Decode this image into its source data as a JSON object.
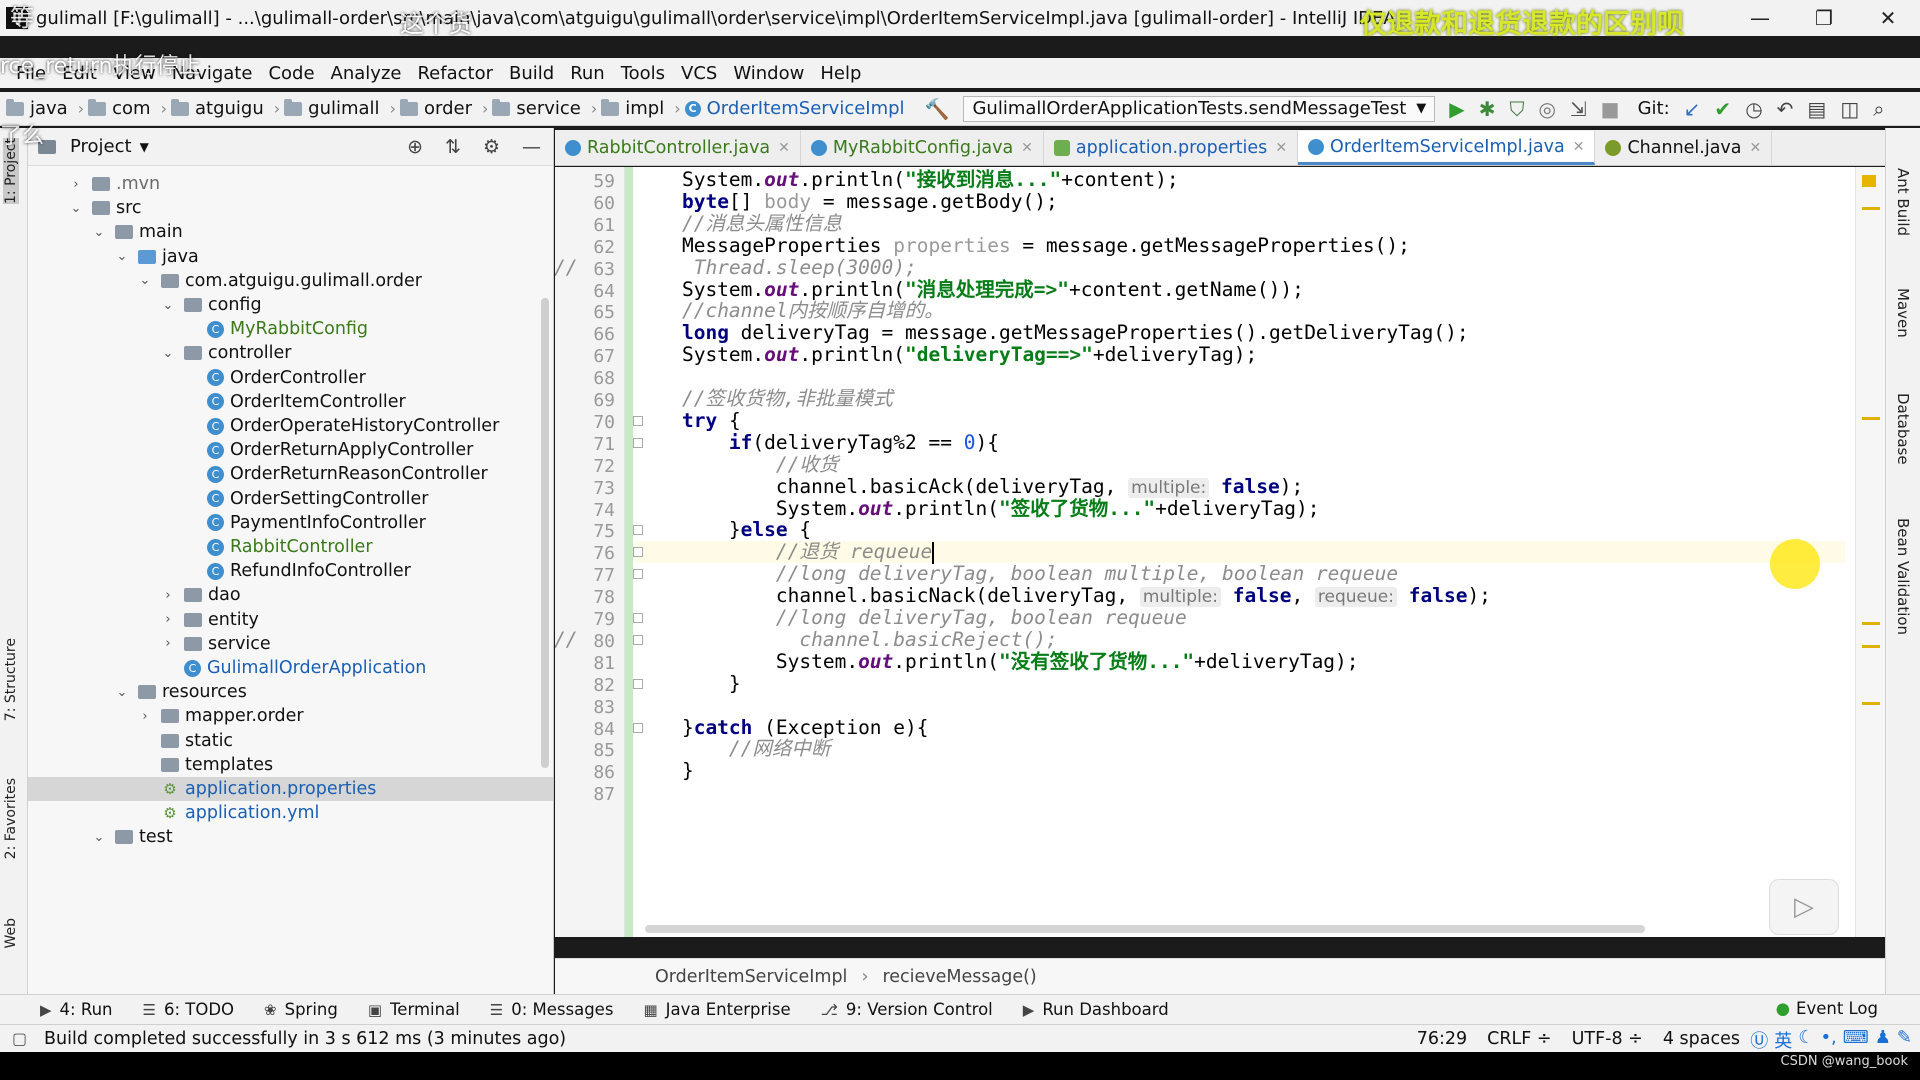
{
  "window": {
    "title": "gulimall [F:\\gulimall] - ...\\gulimall-order\\src\\main\\java\\com\\atguigu\\gulimall\\order\\service\\impl\\OrderItemServiceImpl.java [gulimall-order] - IntelliJ IDEA",
    "overlay_caption": "仅退款和退货退款的区别呗",
    "minimize": "—",
    "restore": "❐",
    "close": "✕"
  },
  "video_overlay": {
    "top_left_text_1": "等",
    "top_left_text_2": "这个货",
    "subtitle_1": "rce_return执行停止",
    "subtitle_2": "了么"
  },
  "menu": [
    "File",
    "Edit",
    "View",
    "Navigate",
    "Code",
    "Analyze",
    "Refactor",
    "Build",
    "Run",
    "Tools",
    "VCS",
    "Window",
    "Help"
  ],
  "breadcrumb": [
    "java",
    "com",
    "atguigu",
    "gulimall",
    "order",
    "service",
    "impl"
  ],
  "breadcrumb_active": "OrderItemServiceImpl",
  "run_config": "GulimallOrderApplicationTests.sendMessageTest",
  "git_label": "Git:",
  "project_panel": {
    "title": "Project",
    "rows": [
      {
        "label": ".mvn",
        "depth": 2,
        "kind": "folder",
        "arrow": "›",
        "muted": true
      },
      {
        "label": "src",
        "depth": 2,
        "kind": "folder",
        "arrow": "⌄"
      },
      {
        "label": "main",
        "depth": 3,
        "kind": "folder",
        "arrow": "⌄"
      },
      {
        "label": "java",
        "depth": 4,
        "kind": "folder-blue",
        "arrow": "⌄"
      },
      {
        "label": "com.atguigu.gulimall.order",
        "depth": 5,
        "kind": "folder",
        "arrow": "⌄"
      },
      {
        "label": "config",
        "depth": 6,
        "kind": "folder",
        "arrow": "⌄"
      },
      {
        "label": "MyRabbitConfig",
        "depth": 7,
        "kind": "class",
        "color": "green"
      },
      {
        "label": "controller",
        "depth": 6,
        "kind": "folder",
        "arrow": "⌄"
      },
      {
        "label": "OrderController",
        "depth": 7,
        "kind": "class"
      },
      {
        "label": "OrderItemController",
        "depth": 7,
        "kind": "class"
      },
      {
        "label": "OrderOperateHistoryController",
        "depth": 7,
        "kind": "class"
      },
      {
        "label": "OrderReturnApplyController",
        "depth": 7,
        "kind": "class"
      },
      {
        "label": "OrderReturnReasonController",
        "depth": 7,
        "kind": "class"
      },
      {
        "label": "OrderSettingController",
        "depth": 7,
        "kind": "class"
      },
      {
        "label": "PaymentInfoController",
        "depth": 7,
        "kind": "class"
      },
      {
        "label": "RabbitController",
        "depth": 7,
        "kind": "class",
        "color": "green"
      },
      {
        "label": "RefundInfoController",
        "depth": 7,
        "kind": "class"
      },
      {
        "label": "dao",
        "depth": 6,
        "kind": "folder",
        "arrow": "›"
      },
      {
        "label": "entity",
        "depth": 6,
        "kind": "folder",
        "arrow": "›"
      },
      {
        "label": "service",
        "depth": 6,
        "kind": "folder",
        "arrow": "›"
      },
      {
        "label": "GulimallOrderApplication",
        "depth": 6,
        "kind": "class",
        "color": "blue"
      },
      {
        "label": "resources",
        "depth": 4,
        "kind": "folder",
        "arrow": "⌄"
      },
      {
        "label": "mapper.order",
        "depth": 5,
        "kind": "folder",
        "arrow": "›"
      },
      {
        "label": "static",
        "depth": 5,
        "kind": "folder"
      },
      {
        "label": "templates",
        "depth": 5,
        "kind": "folder"
      },
      {
        "label": "application.properties",
        "depth": 5,
        "kind": "prop",
        "color": "blue",
        "selected": true
      },
      {
        "label": "application.yml",
        "depth": 5,
        "kind": "prop",
        "color": "blue"
      },
      {
        "label": "test",
        "depth": 3,
        "kind": "folder",
        "arrow": "⌄"
      }
    ]
  },
  "editor_tabs": [
    {
      "label": "RabbitController.java",
      "icon": "class",
      "color": "green"
    },
    {
      "label": "MyRabbitConfig.java",
      "icon": "class",
      "color": "green"
    },
    {
      "label": "application.properties",
      "icon": "prop",
      "color": "blue"
    },
    {
      "label": "OrderItemServiceImpl.java",
      "icon": "class",
      "color": "blue",
      "active": true
    },
    {
      "label": "Channel.java",
      "icon": "iface",
      "color": "black"
    }
  ],
  "code": {
    "first_line": 59,
    "current_line": 76,
    "lines": [
      [
        {
          "t": "    System."
        },
        {
          "t": "out",
          "c": "fld"
        },
        {
          "t": ".println("
        },
        {
          "t": "\"接收到消息...\"",
          "c": "str"
        },
        {
          "t": "+content);"
        }
      ],
      [
        {
          "t": "    "
        },
        {
          "t": "byte",
          "c": "kw"
        },
        {
          "t": "[] "
        },
        {
          "t": "body",
          "c": "unused"
        },
        {
          "t": " = message.getBody();"
        }
      ],
      [
        {
          "t": "    "
        },
        {
          "t": "//消息头属性信息",
          "c": "cm"
        }
      ],
      [
        {
          "t": "    MessageProperties "
        },
        {
          "t": "properties",
          "c": "unused"
        },
        {
          "t": " = message.getMessageProperties();"
        }
      ],
      [
        {
          "t": "     "
        },
        {
          "t": "Thread.sleep(3000);",
          "c": "cm"
        }
      ],
      [
        {
          "t": "    System."
        },
        {
          "t": "out",
          "c": "fld"
        },
        {
          "t": ".println("
        },
        {
          "t": "\"消息处理完成=>\"",
          "c": "str"
        },
        {
          "t": "+content.getName());"
        }
      ],
      [
        {
          "t": "    "
        },
        {
          "t": "//channel内按顺序自增的。",
          "c": "cm"
        }
      ],
      [
        {
          "t": "    "
        },
        {
          "t": "long",
          "c": "kw"
        },
        {
          "t": " deliveryTag = message.getMessageProperties().getDeliveryTag();"
        }
      ],
      [
        {
          "t": "    System."
        },
        {
          "t": "out",
          "c": "fld"
        },
        {
          "t": ".println("
        },
        {
          "t": "\"deliveryTag==>\"",
          "c": "str"
        },
        {
          "t": "+deliveryTag);"
        }
      ],
      [
        {
          "t": ""
        }
      ],
      [
        {
          "t": "    "
        },
        {
          "t": "//签收货物,非批量模式",
          "c": "cm"
        }
      ],
      [
        {
          "t": "    "
        },
        {
          "t": "try",
          "c": "kw"
        },
        {
          "t": " {"
        }
      ],
      [
        {
          "t": "        "
        },
        {
          "t": "if",
          "c": "kw"
        },
        {
          "t": "(deliveryTag%2 == "
        },
        {
          "t": "0",
          "c": "num"
        },
        {
          "t": "){"
        }
      ],
      [
        {
          "t": "            "
        },
        {
          "t": "//收货",
          "c": "cm"
        }
      ],
      [
        {
          "t": "            channel.basicAck(deliveryTag, "
        },
        {
          "t": "multiple:",
          "c": "hint"
        },
        {
          "t": " "
        },
        {
          "t": "false",
          "c": "kw"
        },
        {
          "t": ");"
        }
      ],
      [
        {
          "t": "            System."
        },
        {
          "t": "out",
          "c": "fld"
        },
        {
          "t": ".println("
        },
        {
          "t": "\"签收了货物...\"",
          "c": "str"
        },
        {
          "t": "+deliveryTag);"
        }
      ],
      [
        {
          "t": "        }"
        },
        {
          "t": "else",
          "c": "kw"
        },
        {
          "t": " {"
        }
      ],
      [
        {
          "t": "            "
        },
        {
          "t": "//退货 requeue",
          "c": "cm"
        },
        {
          "t": "",
          "c": "caret"
        }
      ],
      [
        {
          "t": "            "
        },
        {
          "t": "//long deliveryTag, boolean multiple, boolean requeue",
          "c": "cm"
        }
      ],
      [
        {
          "t": "            channel.basicNack(deliveryTag, "
        },
        {
          "t": "multiple:",
          "c": "hint"
        },
        {
          "t": " "
        },
        {
          "t": "false",
          "c": "kw"
        },
        {
          "t": ", "
        },
        {
          "t": "requeue:",
          "c": "hint"
        },
        {
          "t": " "
        },
        {
          "t": "false",
          "c": "kw"
        },
        {
          "t": ");"
        }
      ],
      [
        {
          "t": "            "
        },
        {
          "t": "//long deliveryTag, boolean requeue",
          "c": "cm"
        }
      ],
      [
        {
          "t": "              "
        },
        {
          "t": "channel.basicReject();",
          "c": "cm"
        }
      ],
      [
        {
          "t": "            System."
        },
        {
          "t": "out",
          "c": "fld"
        },
        {
          "t": ".println("
        },
        {
          "t": "\"没有签收了货物...\"",
          "c": "str"
        },
        {
          "t": "+deliveryTag);"
        }
      ],
      [
        {
          "t": "        }"
        }
      ],
      [
        {
          "t": ""
        }
      ],
      [
        {
          "t": "    }"
        },
        {
          "t": "catch",
          "c": "kw"
        },
        {
          "t": " (Exception e){"
        }
      ],
      [
        {
          "t": "        "
        },
        {
          "t": "//网络中断",
          "c": "cm"
        }
      ],
      [
        {
          "t": "    }"
        }
      ],
      [
        {
          "t": ""
        }
      ]
    ],
    "comment_prefix_lines": [
      63,
      80
    ]
  },
  "editor_breadcrumb": [
    "OrderItemServiceImpl",
    "recieveMessage()"
  ],
  "left_stripe": [
    "1: Project",
    "7: Structure",
    "2: Favorites",
    "Web"
  ],
  "right_stripe": [
    "Ant Build",
    "Maven",
    "Database",
    "Bean Validation"
  ],
  "bottom_tabs": [
    {
      "icon": "▶",
      "label": "4: Run"
    },
    {
      "icon": "☰",
      "label": "6: TODO"
    },
    {
      "icon": "❀",
      "label": "Spring"
    },
    {
      "icon": "▣",
      "label": "Terminal"
    },
    {
      "icon": "☰",
      "label": "0: Messages"
    },
    {
      "icon": "▦",
      "label": "Java Enterprise"
    },
    {
      "icon": "⎇",
      "label": "9: Version Control"
    },
    {
      "icon": "▶",
      "label": "Run Dashboard"
    }
  ],
  "event_log": "Event Log",
  "status": {
    "message": "Build completed successfully in 3 s 612 ms (3 minutes ago)",
    "position": "76:29",
    "line_sep": "CRLF ÷",
    "encoding": "UTF-8 ÷",
    "indent": "4 spaces",
    "ime": "英"
  },
  "watermark": "CSDN @wang_book"
}
